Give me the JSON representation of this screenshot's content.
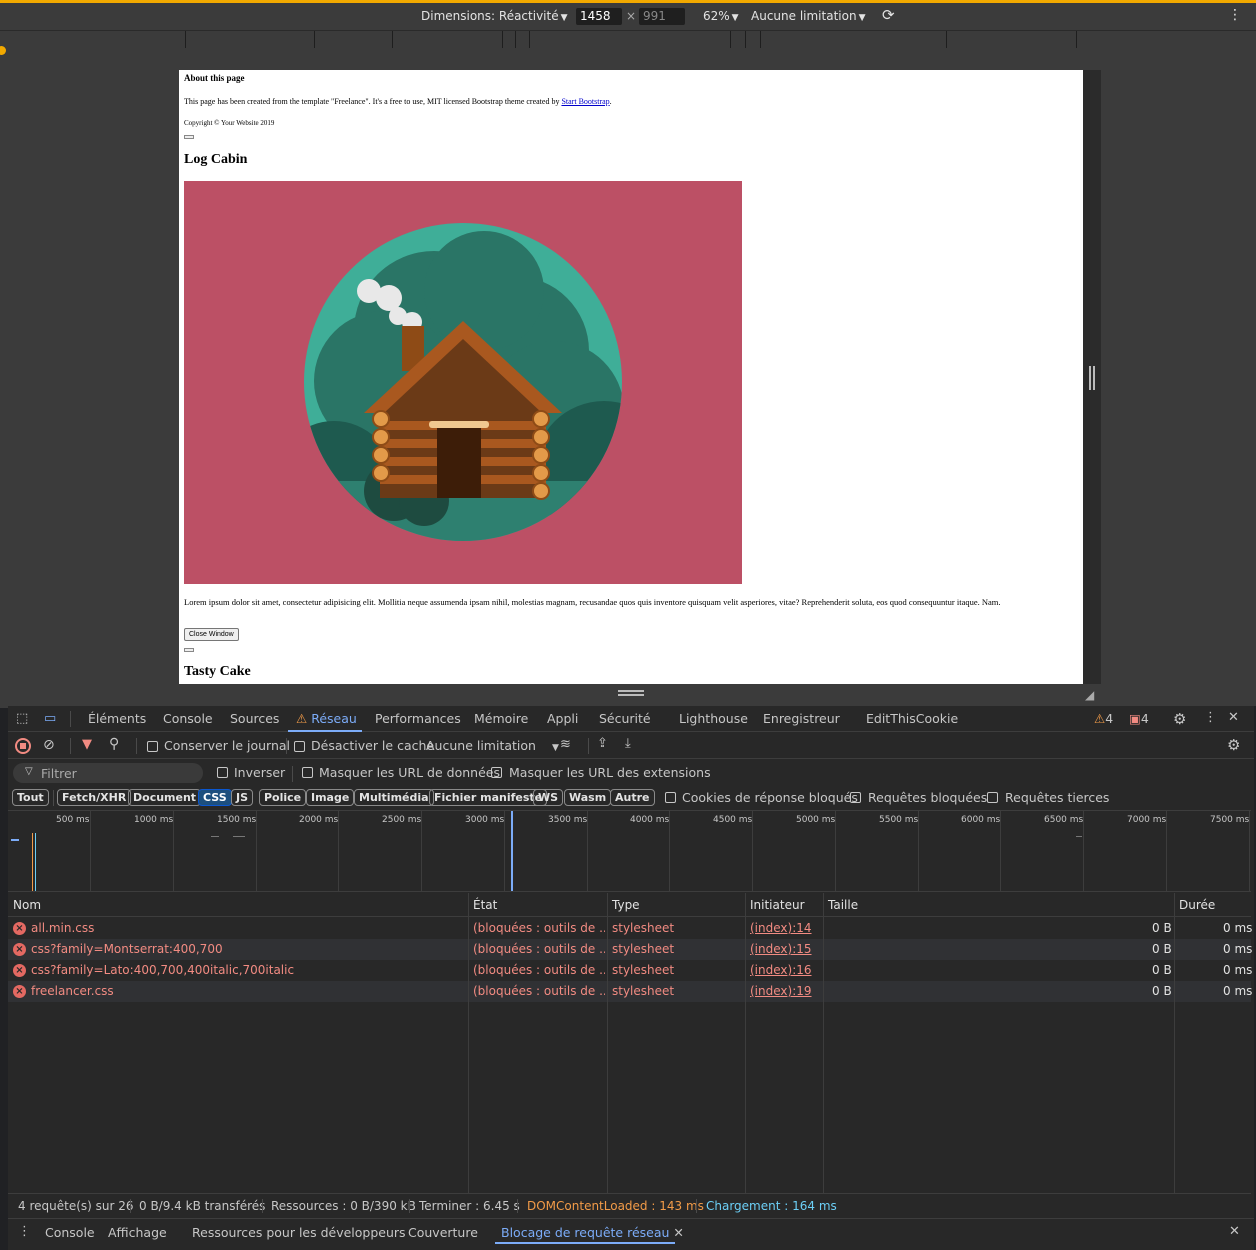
{
  "device_toolbar": {
    "dimensions_label": "Dimensions: Réactivité",
    "width": "1458",
    "height": "991",
    "times": "×",
    "zoom": "62%",
    "throttle": "Aucune limitation"
  },
  "page": {
    "about_heading": "About this page",
    "about_text_before": "This page has been created from the template \"Freelance\". It's a free to use, MIT licensed Bootstrap theme created by",
    "about_link": "Start Bootstrap",
    "about_text_after": ".",
    "copyright": "Copyright © Your Website 2019",
    "log_cabin_title": "Log Cabin",
    "lorem": "Lorem ipsum dolor sit amet, consectetur adipisicing elit. Mollitia neque assumenda ipsam nihil, molestias magnam, recusandae quos quis inventore quisquam velit asperiores, vitae? Reprehenderit soluta, eos quod consequuntur itaque. Nam.",
    "close_window": "Close Window",
    "tasty_cake_title": "Tasty Cake"
  },
  "devtools_tabs": [
    "Éléments",
    "Console",
    "Sources",
    "Réseau",
    "Performances",
    "Mémoire",
    "Appli",
    "Sécurité",
    "Lighthouse",
    "Enregistreur",
    "EditThisCookie"
  ],
  "badges": {
    "warnings": "4",
    "issues": "4"
  },
  "network_toolbar": {
    "preserve_log": "Conserver le journal",
    "disable_cache": "Désactiver le cache",
    "throttle": "Aucune limitation"
  },
  "filter_row": {
    "placeholder": "Filtrer",
    "invert": "Inverser",
    "hide_data_urls": "Masquer les URL de données",
    "hide_ext_urls": "Masquer les URL des extensions"
  },
  "type_chips": [
    "Tout",
    "Fetch/XHR",
    "Document",
    "CSS",
    "JS",
    "Police",
    "Image",
    "Multimédia",
    "Fichier manifeste",
    "WS",
    "Wasm",
    "Autre"
  ],
  "active_chip": "CSS",
  "chip_checkboxes": {
    "blocked_cookies": "Cookies de réponse bloqués",
    "blocked_requests": "Requêtes bloquées",
    "third_party": "Requêtes tierces"
  },
  "timeline_labels": [
    "500 ms",
    "1000 ms",
    "1500 ms",
    "2000 ms",
    "2500 ms",
    "3000 ms",
    "3500 ms",
    "4000 ms",
    "4500 ms",
    "5000 ms",
    "5500 ms",
    "6000 ms",
    "6500 ms",
    "7000 ms",
    "7500 ms"
  ],
  "table": {
    "headers": {
      "name": "Nom",
      "status": "État",
      "type": "Type",
      "initiator": "Initiateur",
      "size": "Taille",
      "time": "Durée"
    },
    "rows": [
      {
        "name": "all.min.css",
        "status": "(bloquées : outils de ...",
        "type": "stylesheet",
        "initiator": "(index):14",
        "size": "0 B",
        "time": "0 ms"
      },
      {
        "name": "css?family=Montserrat:400,700",
        "status": "(bloquées : outils de ...",
        "type": "stylesheet",
        "initiator": "(index):15",
        "size": "0 B",
        "time": "0 ms"
      },
      {
        "name": "css?family=Lato:400,700,400italic,700italic",
        "status": "(bloquées : outils de ...",
        "type": "stylesheet",
        "initiator": "(index):16",
        "size": "0 B",
        "time": "0 ms"
      },
      {
        "name": "freelancer.css",
        "status": "(bloquées : outils de ...",
        "type": "stylesheet",
        "initiator": "(index):19",
        "size": "0 B",
        "time": "0 ms"
      }
    ]
  },
  "status_bar": {
    "requests": "4 requête(s) sur 26",
    "transferred": "0 B/9.4 kB transférés",
    "resources": "Ressources : 0 B/390 kB",
    "finish": "Terminer : 6.45 s",
    "dcl": "DOMContentLoaded : 143 ms",
    "load": "Chargement : 164 ms"
  },
  "drawer_tabs": [
    "Console",
    "Affichage",
    "Ressources pour les développeurs",
    "Couverture",
    "Blocage de requête réseau"
  ],
  "colors": {
    "accent": "#7cacf8",
    "error": "#f28b82",
    "dcl": "#f29b48",
    "load": "#6ccff6",
    "image_bg": "#bc5065"
  }
}
